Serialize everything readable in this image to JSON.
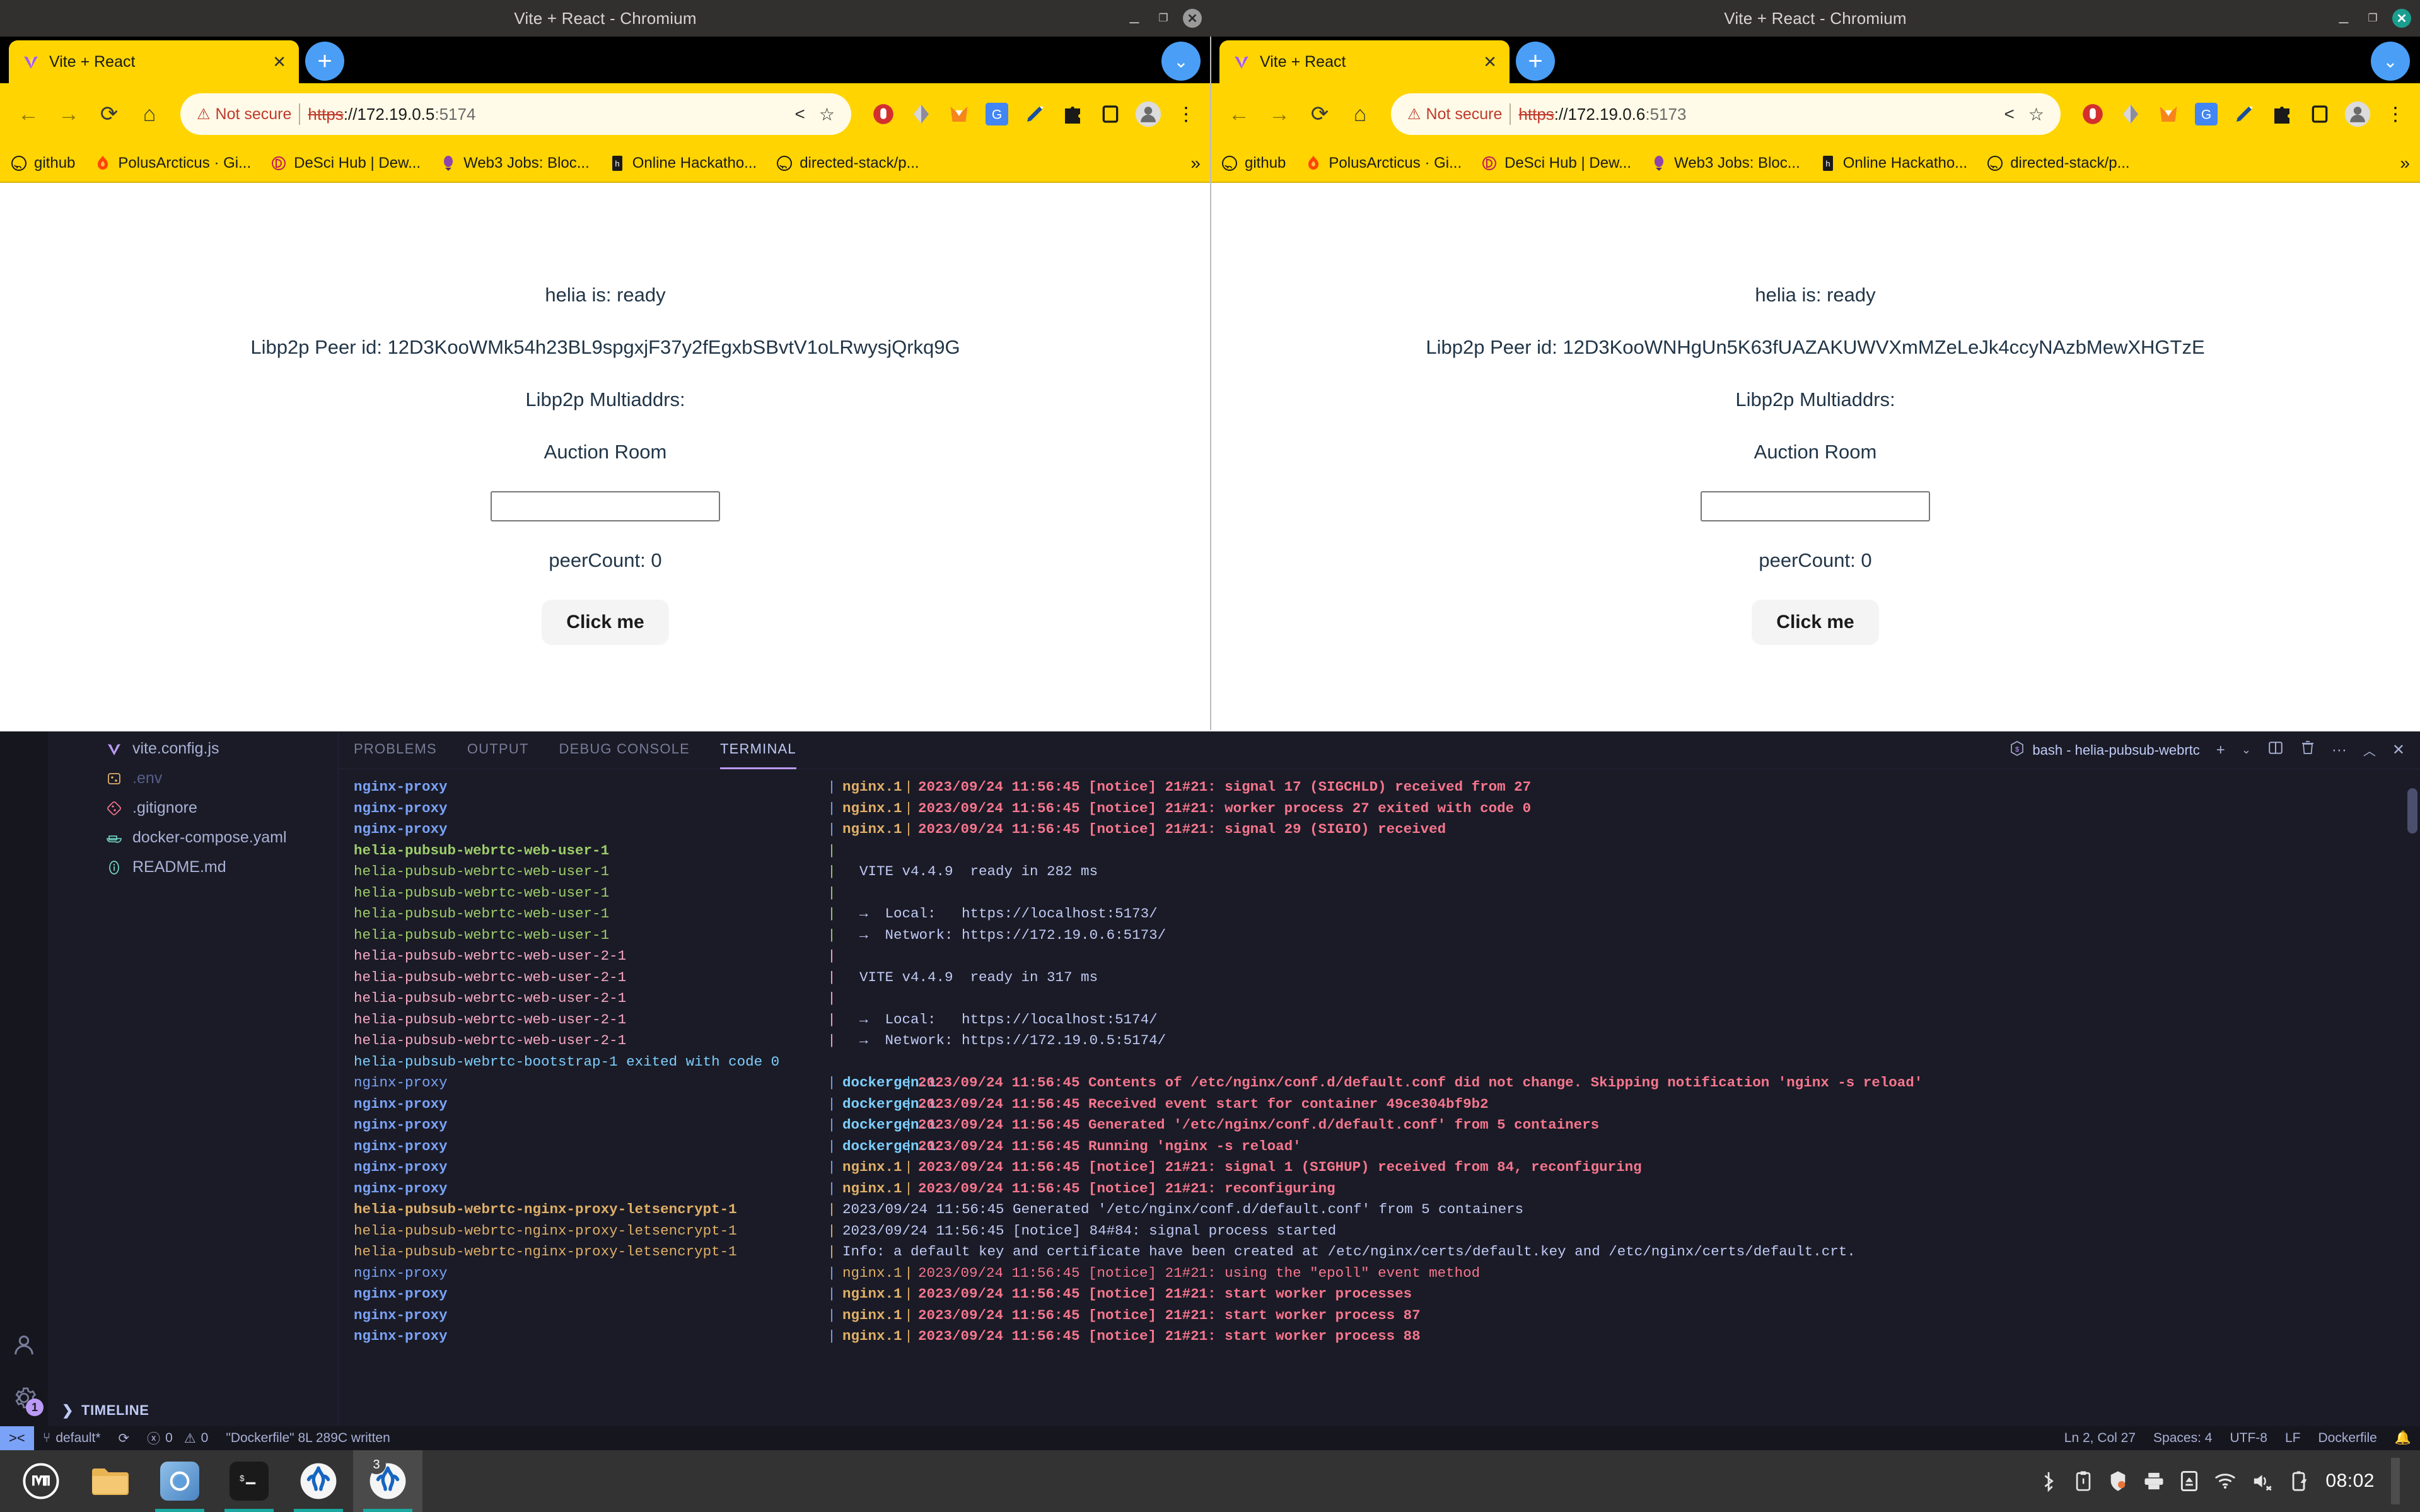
{
  "browsers": [
    {
      "window_title": "Vite + React - Chromium",
      "tab_label": "Vite + React",
      "security_label": "Not secure",
      "url_scheme": "https",
      "url_sep": "://",
      "url_host": "172.19.0.5",
      "url_port": ":5174",
      "page": {
        "status": "helia is: ready",
        "peer_id": "Libp2p Peer id: 12D3KooWMk54h23BL9spgxjF37y2fEgxbSBvtV1oLRwysjQrkq9G",
        "multiaddrs": "Libp2p Multiaddrs:",
        "room_label": "Auction Room",
        "room_value": "",
        "room_placeholder": "",
        "peer_count": "peerCount: 0",
        "button": "Click me"
      }
    },
    {
      "window_title": "Vite + React - Chromium",
      "tab_label": "Vite + React",
      "security_label": "Not secure",
      "url_scheme": "https",
      "url_sep": "://",
      "url_host": "172.19.0.6",
      "url_port": ":5173",
      "page": {
        "status": "helia is: ready",
        "peer_id": "Libp2p Peer id: 12D3KooWNHgUn5K63fUAZAKUWVXmMZeLeJk4ccyNAzbMewXHGTzE",
        "multiaddrs": "Libp2p Multiaddrs:",
        "room_label": "Auction Room",
        "room_value": "",
        "room_placeholder": "",
        "peer_count": "peerCount: 0",
        "button": "Click me"
      }
    }
  ],
  "bookmarks": [
    {
      "label": "github",
      "icon": "github-icon"
    },
    {
      "label": "PolusArcticus · Gi...",
      "icon": "flame-icon"
    },
    {
      "label": "DeSci Hub | Dew...",
      "icon": "desci-icon"
    },
    {
      "label": "Web3 Jobs: Bloc...",
      "icon": "web3jobs-icon"
    },
    {
      "label": "Online Hackatho...",
      "icon": "hackathon-icon"
    },
    {
      "label": "directed-stack/p...",
      "icon": "github-icon"
    }
  ],
  "bookmarks_overflow": "»",
  "vscode": {
    "explorer_files": [
      {
        "name": "vite.config.js",
        "icon": "vite-icon",
        "muted": false
      },
      {
        "name": ".env",
        "icon": "env-icon",
        "muted": true
      },
      {
        "name": ".gitignore",
        "icon": "git-icon",
        "muted": false
      },
      {
        "name": "docker-compose.yaml",
        "icon": "docker-icon",
        "muted": false
      },
      {
        "name": "README.md",
        "icon": "info-icon",
        "muted": false
      }
    ],
    "timeline_label": "TIMELINE",
    "panel_tabs": [
      {
        "label": "PROBLEMS",
        "active": false
      },
      {
        "label": "OUTPUT",
        "active": false
      },
      {
        "label": "DEBUG CONSOLE",
        "active": false
      },
      {
        "label": "TERMINAL",
        "active": true
      }
    ],
    "shell_name": "bash - helia-pubsub-webrtc",
    "panel_actions": [
      "add-terminal",
      "terminal-dropdown",
      "split-terminal",
      "kill-terminal",
      "more-actions",
      "maximize-panel",
      "close-panel"
    ],
    "terminal_lines": [
      {
        "svc": "nginx-proxy",
        "svc_color": "#7aa2f7",
        "bold": true,
        "bar_color": "#7aa2f7",
        "sub": "nginx.1",
        "sub_color": "#e0af68",
        "sub_bold": true,
        "sub_bar_color": "#e0af68",
        "msg": "2023/09/24 11:56:45 [notice] 21#21: signal 17 (SIGCHLD) received from 27",
        "msg_color": "#f7768e",
        "msg_bold": true
      },
      {
        "svc": "nginx-proxy",
        "svc_color": "#7aa2f7",
        "bold": true,
        "bar_color": "#7aa2f7",
        "sub": "nginx.1",
        "sub_color": "#e0af68",
        "sub_bold": true,
        "sub_bar_color": "#e0af68",
        "msg": "2023/09/24 11:56:45 [notice] 21#21: worker process 27 exited with code 0",
        "msg_color": "#f7768e",
        "msg_bold": true
      },
      {
        "svc": "nginx-proxy",
        "svc_color": "#7aa2f7",
        "bold": true,
        "bar_color": "#7aa2f7",
        "sub": "nginx.1",
        "sub_color": "#e0af68",
        "sub_bold": true,
        "sub_bar_color": "#e0af68",
        "msg": "2023/09/24 11:56:45 [notice] 21#21: signal 29 (SIGIO) received",
        "msg_color": "#f7768e",
        "msg_bold": true
      },
      {
        "svc": "helia-pubsub-webrtc-web-user-1",
        "svc_color": "#9ece6a",
        "bold": true,
        "bar_color": "#9ece6a",
        "sub": "",
        "sub_color": "",
        "sub_bold": false,
        "sub_bar_color": "",
        "msg": "",
        "msg_color": "#c0caf5",
        "msg_bold": false
      },
      {
        "svc": "helia-pubsub-webrtc-web-user-1",
        "svc_color": "#9ece6a",
        "bold": false,
        "bar_color": "#9ece6a",
        "sub": "",
        "sub_color": "",
        "sub_bold": false,
        "sub_bar_color": "",
        "msg": "  VITE v4.4.9  ready in 282 ms",
        "msg_color": "#c0caf5",
        "msg_bold": false
      },
      {
        "svc": "helia-pubsub-webrtc-web-user-1",
        "svc_color": "#9ece6a",
        "bold": false,
        "bar_color": "#9ece6a",
        "sub": "",
        "sub_color": "",
        "sub_bold": false,
        "sub_bar_color": "",
        "msg": "",
        "msg_color": "#c0caf5",
        "msg_bold": false
      },
      {
        "svc": "helia-pubsub-webrtc-web-user-1",
        "svc_color": "#9ece6a",
        "bold": false,
        "bar_color": "#9ece6a",
        "sub": "",
        "sub_color": "",
        "sub_bold": false,
        "sub_bar_color": "",
        "msg": "  →  Local:   https://localhost:5173/",
        "msg_color": "#c0caf5",
        "msg_bold": false
      },
      {
        "svc": "helia-pubsub-webrtc-web-user-1",
        "svc_color": "#9ece6a",
        "bold": false,
        "bar_color": "#9ece6a",
        "sub": "",
        "sub_color": "",
        "sub_bold": false,
        "sub_bar_color": "",
        "msg": "  →  Network: https://172.19.0.6:5173/",
        "msg_color": "#c0caf5",
        "msg_bold": false
      },
      {
        "svc": "helia-pubsub-webrtc-web-user-2-1",
        "svc_color": "#f7a8c4",
        "bold": false,
        "bar_color": "#f7a8c4",
        "sub": "",
        "sub_color": "",
        "sub_bold": false,
        "sub_bar_color": "",
        "msg": "",
        "msg_color": "#c0caf5",
        "msg_bold": false
      },
      {
        "svc": "helia-pubsub-webrtc-web-user-2-1",
        "svc_color": "#f7a8c4",
        "bold": false,
        "bar_color": "#f7a8c4",
        "sub": "",
        "sub_color": "",
        "sub_bold": false,
        "sub_bar_color": "",
        "msg": "  VITE v4.4.9  ready in 317 ms",
        "msg_color": "#c0caf5",
        "msg_bold": false
      },
      {
        "svc": "helia-pubsub-webrtc-web-user-2-1",
        "svc_color": "#f7a8c4",
        "bold": false,
        "bar_color": "#f7a8c4",
        "sub": "",
        "sub_color": "",
        "sub_bold": false,
        "sub_bar_color": "",
        "msg": "",
        "msg_color": "#c0caf5",
        "msg_bold": false
      },
      {
        "svc": "helia-pubsub-webrtc-web-user-2-1",
        "svc_color": "#f7a8c4",
        "bold": false,
        "bar_color": "#f7a8c4",
        "sub": "",
        "sub_color": "",
        "sub_bold": false,
        "sub_bar_color": "",
        "msg": "  →  Local:   https://localhost:5174/",
        "msg_color": "#c0caf5",
        "msg_bold": false
      },
      {
        "svc": "helia-pubsub-webrtc-web-user-2-1",
        "svc_color": "#f7a8c4",
        "bold": false,
        "bar_color": "#f7a8c4",
        "sub": "",
        "sub_color": "",
        "sub_bold": false,
        "sub_bar_color": "",
        "msg": "  →  Network: https://172.19.0.5:5174/",
        "msg_color": "#c0caf5",
        "msg_bold": false
      },
      {
        "svc": "helia-pubsub-webrtc-bootstrap-1 exited with code 0",
        "svc_color": "#7dcfff",
        "bold": false,
        "bar_color": "",
        "sub": "",
        "sub_color": "",
        "sub_bold": false,
        "sub_bar_color": "",
        "msg": "",
        "msg_color": "",
        "msg_bold": false,
        "full": true
      },
      {
        "svc": "nginx-proxy",
        "svc_color": "#7aa2f7",
        "bold": false,
        "bar_color": "#7aa2f7",
        "sub": "dockergen.1",
        "sub_color": "#7dcfff",
        "sub_bold": true,
        "sub_bar_color": "#7dcfff",
        "msg": "2023/09/24 11:56:45 Contents of /etc/nginx/conf.d/default.conf did not change. Skipping notification 'nginx -s reload'",
        "msg_color": "#f7768e",
        "msg_bold": true
      },
      {
        "svc": "nginx-proxy",
        "svc_color": "#7aa2f7",
        "bold": true,
        "bar_color": "#7aa2f7",
        "sub": "dockergen.1",
        "sub_color": "#7dcfff",
        "sub_bold": true,
        "sub_bar_color": "#7dcfff",
        "msg": "2023/09/24 11:56:45 Received event start for container 49ce304bf9b2",
        "msg_color": "#f7768e",
        "msg_bold": true
      },
      {
        "svc": "nginx-proxy",
        "svc_color": "#7aa2f7",
        "bold": true,
        "bar_color": "#7aa2f7",
        "sub": "dockergen.1",
        "sub_color": "#7dcfff",
        "sub_bold": true,
        "sub_bar_color": "#7dcfff",
        "msg": "2023/09/24 11:56:45 Generated '/etc/nginx/conf.d/default.conf' from 5 containers",
        "msg_color": "#f7768e",
        "msg_bold": true
      },
      {
        "svc": "nginx-proxy",
        "svc_color": "#7aa2f7",
        "bold": true,
        "bar_color": "#7aa2f7",
        "sub": "dockergen.1",
        "sub_color": "#7dcfff",
        "sub_bold": true,
        "sub_bar_color": "#7dcfff",
        "msg": "2023/09/24 11:56:45 Running 'nginx -s reload'",
        "msg_color": "#f7768e",
        "msg_bold": true
      },
      {
        "svc": "nginx-proxy",
        "svc_color": "#7aa2f7",
        "bold": true,
        "bar_color": "#7aa2f7",
        "sub": "nginx.1",
        "sub_color": "#e0af68",
        "sub_bold": true,
        "sub_bar_color": "#e0af68",
        "msg": "2023/09/24 11:56:45 [notice] 21#21: signal 1 (SIGHUP) received from 84, reconfiguring",
        "msg_color": "#f7768e",
        "msg_bold": true
      },
      {
        "svc": "nginx-proxy",
        "svc_color": "#7aa2f7",
        "bold": true,
        "bar_color": "#7aa2f7",
        "sub": "nginx.1",
        "sub_color": "#e0af68",
        "sub_bold": true,
        "sub_bar_color": "#e0af68",
        "msg": "2023/09/24 11:56:45 [notice] 21#21: reconfiguring",
        "msg_color": "#f7768e",
        "msg_bold": true
      },
      {
        "svc": "helia-pubsub-webrtc-nginx-proxy-letsencrypt-1",
        "svc_color": "#e0af68",
        "bold": true,
        "bar_color": "#e0af68",
        "sub": "",
        "sub_color": "",
        "sub_bold": false,
        "sub_bar_color": "",
        "msg": "2023/09/24 11:56:45 Generated '/etc/nginx/conf.d/default.conf' from 5 containers",
        "msg_color": "#c0caf5",
        "msg_bold": false
      },
      {
        "svc": "helia-pubsub-webrtc-nginx-proxy-letsencrypt-1",
        "svc_color": "#e0af68",
        "bold": false,
        "bar_color": "#e0af68",
        "sub": "",
        "sub_color": "",
        "sub_bold": false,
        "sub_bar_color": "",
        "msg": "2023/09/24 11:56:45 [notice] 84#84: signal process started",
        "msg_color": "#c0caf5",
        "msg_bold": false
      },
      {
        "svc": "helia-pubsub-webrtc-nginx-proxy-letsencrypt-1",
        "svc_color": "#e0af68",
        "bold": false,
        "bar_color": "#e0af68",
        "sub": "",
        "sub_color": "",
        "sub_bold": false,
        "sub_bar_color": "",
        "msg": "Info: a default key and certificate have been created at /etc/nginx/certs/default.key and /etc/nginx/certs/default.crt.",
        "msg_color": "#c0caf5",
        "msg_bold": false
      },
      {
        "svc": "nginx-proxy",
        "svc_color": "#7aa2f7",
        "bold": false,
        "bar_color": "#7aa2f7",
        "sub": "nginx.1",
        "sub_color": "#e0af68",
        "sub_bold": false,
        "sub_bar_color": "#e0af68",
        "msg": "2023/09/24 11:56:45 [notice] 21#21: using the \"epoll\" event method",
        "msg_color": "#f7768e",
        "msg_bold": false
      },
      {
        "svc": "nginx-proxy",
        "svc_color": "#7aa2f7",
        "bold": true,
        "bar_color": "#7aa2f7",
        "sub": "nginx.1",
        "sub_color": "#e0af68",
        "sub_bold": true,
        "sub_bar_color": "#e0af68",
        "msg": "2023/09/24 11:56:45 [notice] 21#21: start worker processes",
        "msg_color": "#f7768e",
        "msg_bold": true
      },
      {
        "svc": "nginx-proxy",
        "svc_color": "#7aa2f7",
        "bold": true,
        "bar_color": "#7aa2f7",
        "sub": "nginx.1",
        "sub_color": "#e0af68",
        "sub_bold": true,
        "sub_bar_color": "#e0af68",
        "msg": "2023/09/24 11:56:45 [notice] 21#21: start worker process 87",
        "msg_color": "#f7768e",
        "msg_bold": true
      },
      {
        "svc": "nginx-proxy",
        "svc_color": "#7aa2f7",
        "bold": true,
        "bar_color": "#7aa2f7",
        "sub": "nginx.1",
        "sub_color": "#e0af68",
        "sub_bold": true,
        "sub_bar_color": "#e0af68",
        "msg": "2023/09/24 11:56:45 [notice] 21#21: start worker process 88",
        "msg_color": "#f7768e",
        "msg_bold": true
      }
    ],
    "status_bar": {
      "remote": "remote-indicator",
      "branch": "default*",
      "sync": "sync-icon",
      "errors": "0",
      "warnings": "0",
      "message": "\"Dockerfile\" 8L 289C written",
      "position": "Ln 2, Col 27",
      "spaces": "Spaces: 4",
      "encoding": "UTF-8",
      "eol": "LF",
      "language": "Dockerfile",
      "bell": "notifications-bell"
    }
  },
  "taskbar": {
    "apps": [
      {
        "name": "menu-mint",
        "active": false,
        "running": false
      },
      {
        "name": "files",
        "active": false,
        "running": false
      },
      {
        "name": "chromium",
        "active": false,
        "running": true
      },
      {
        "name": "terminal",
        "active": false,
        "running": true
      },
      {
        "name": "vscode",
        "active": false,
        "running": true
      },
      {
        "name": "vscode-2",
        "active": true,
        "running": true,
        "badge": "3"
      }
    ],
    "tray": [
      "bluetooth-icon",
      "clipboard-icon",
      "shield-icon",
      "printer-icon",
      "eject-icon",
      "wifi-icon",
      "volume-muted-icon",
      "battery-charging-icon"
    ],
    "clock": "08:02"
  }
}
